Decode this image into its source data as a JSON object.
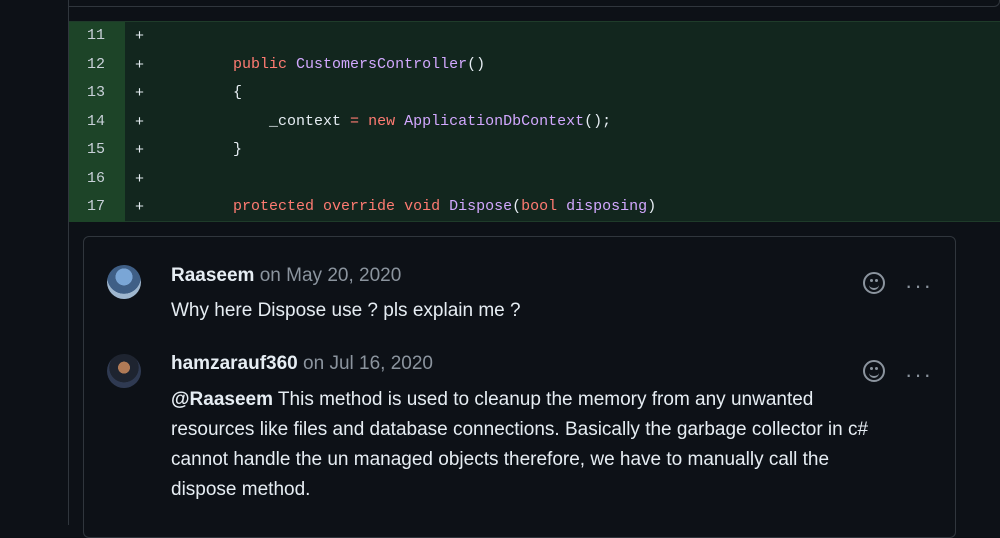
{
  "diff": {
    "lines": [
      {
        "num": "11",
        "sign": "+",
        "tokens": []
      },
      {
        "num": "12",
        "sign": "+",
        "tokens": [
          {
            "t": "        ",
            "c": ""
          },
          {
            "t": "public",
            "c": "kw"
          },
          {
            "t": " ",
            "c": ""
          },
          {
            "t": "CustomersController",
            "c": "ty"
          },
          {
            "t": "()",
            "c": ""
          }
        ]
      },
      {
        "num": "13",
        "sign": "+",
        "tokens": [
          {
            "t": "        {",
            "c": ""
          }
        ]
      },
      {
        "num": "14",
        "sign": "+",
        "tokens": [
          {
            "t": "            _context ",
            "c": ""
          },
          {
            "t": "=",
            "c": "kw"
          },
          {
            "t": " ",
            "c": ""
          },
          {
            "t": "new",
            "c": "kw"
          },
          {
            "t": " ",
            "c": ""
          },
          {
            "t": "ApplicationDbContext",
            "c": "ty"
          },
          {
            "t": "();",
            "c": ""
          }
        ]
      },
      {
        "num": "15",
        "sign": "+",
        "tokens": [
          {
            "t": "        }",
            "c": ""
          }
        ]
      },
      {
        "num": "16",
        "sign": "+",
        "tokens": []
      },
      {
        "num": "17",
        "sign": "+",
        "tokens": [
          {
            "t": "        ",
            "c": ""
          },
          {
            "t": "protected",
            "c": "kw"
          },
          {
            "t": " ",
            "c": ""
          },
          {
            "t": "override",
            "c": "kw"
          },
          {
            "t": " ",
            "c": ""
          },
          {
            "t": "void",
            "c": "kw"
          },
          {
            "t": " ",
            "c": ""
          },
          {
            "t": "Dispose",
            "c": "ty"
          },
          {
            "t": "(",
            "c": ""
          },
          {
            "t": "bool",
            "c": "kw"
          },
          {
            "t": " ",
            "c": ""
          },
          {
            "t": "disposing",
            "c": "ty"
          },
          {
            "t": ")",
            "c": ""
          }
        ]
      }
    ]
  },
  "comments": [
    {
      "author": "Raaseem",
      "date_prefix": "on",
      "date": "May 20, 2020",
      "mention": "",
      "body": "Why here Dispose use ? pls explain me ?",
      "avatar_icon": "user-avatar-raaseem"
    },
    {
      "author": "hamzarauf360",
      "date_prefix": "on",
      "date": "Jul 16, 2020",
      "mention": "@Raaseem",
      "body": " This method is used to cleanup the memory from any unwanted resources like files and database connections. Basically the garbage collector in c# cannot handle the un managed objects therefore, we have to manually call the dispose method.",
      "avatar_icon": "user-avatar-hamzarauf360"
    }
  ],
  "actions": {
    "reaction_icon": "smiley-icon",
    "more_label": "···"
  }
}
